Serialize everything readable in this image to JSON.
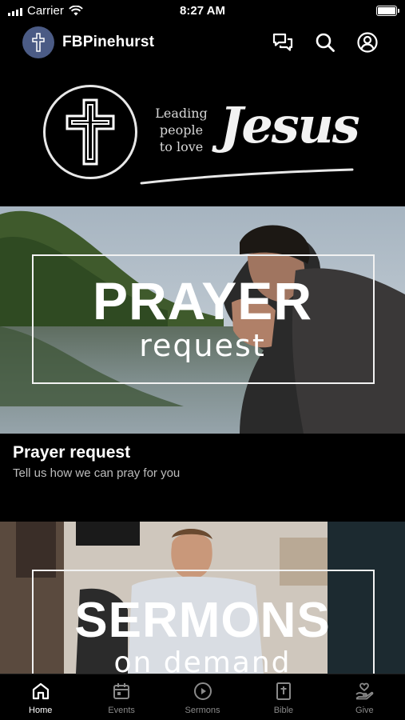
{
  "status_bar": {
    "carrier": "Carrier",
    "time": "8:27 AM"
  },
  "header": {
    "title": "FBPinehurst",
    "icons": [
      "chat-icon",
      "search-icon",
      "profile-icon"
    ]
  },
  "banner": {
    "tagline": "Leading people to love",
    "name": "Jesus"
  },
  "cards": [
    {
      "overlay_big": "PRAYER",
      "overlay_small": "request",
      "title": "Prayer request",
      "subtitle": "Tell us how we can pray for you"
    },
    {
      "overlay_big": "SERMONS",
      "overlay_small": "on demand",
      "title": "",
      "subtitle": ""
    }
  ],
  "tabs": [
    {
      "label": "Home",
      "icon": "home-icon",
      "active": true
    },
    {
      "label": "Events",
      "icon": "calendar-icon",
      "active": false
    },
    {
      "label": "Sermons",
      "icon": "play-icon",
      "active": false
    },
    {
      "label": "Bible",
      "icon": "bible-icon",
      "active": false
    },
    {
      "label": "Give",
      "icon": "give-icon",
      "active": false
    }
  ],
  "colors": {
    "background": "#000000",
    "avatar": "#4b5b85",
    "inactive_tab": "#8a8a8a",
    "subtitle": "#bdbdbd"
  }
}
